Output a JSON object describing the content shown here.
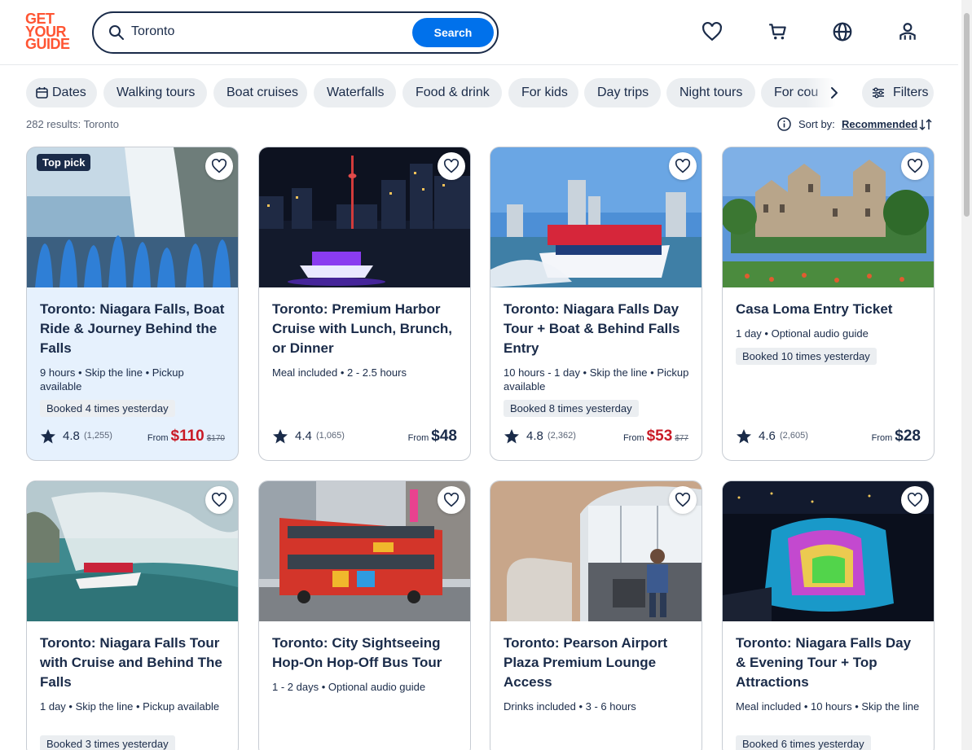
{
  "header": {
    "logo_lines": [
      "GET",
      "YOUR",
      "GUIDE"
    ],
    "search": {
      "value": "Toronto",
      "button_label": "Search"
    },
    "icons": [
      "heart-icon",
      "cart-icon",
      "globe-icon",
      "profile-icon"
    ]
  },
  "chips": [
    "Dates",
    "Walking tours",
    "Boat cruises",
    "Waterfalls",
    "Food & drink",
    "For kids",
    "Day trips",
    "Night tours",
    "For cou"
  ],
  "filters_label": "Filters",
  "results_text": "282 results: Toronto",
  "sort": {
    "label": "Sort by:",
    "value": "Recommended"
  },
  "colors": {
    "brand": "#ff5533",
    "accent": "#0071eb",
    "sale": "#c91a26",
    "text": "#1a2b49"
  },
  "cards": [
    {
      "badge": "Top pick",
      "title": "Toronto: Niagara Falls, Boat Ride & Journey Behind the Falls",
      "meta": "9 hours • Skip the line • Pickup available",
      "booked": "Booked 4 times yesterday",
      "rating": "4.8",
      "reviews": "(1,255)",
      "from": "From",
      "price": "$110",
      "old_price": "$170"
    },
    {
      "title": "Toronto: Premium Harbor Cruise with Lunch, Brunch, or Dinner",
      "meta": "Meal included • 2 - 2.5 hours",
      "rating": "4.4",
      "reviews": "(1,065)",
      "from": "From",
      "price": "$48"
    },
    {
      "title": "Toronto: Niagara Falls Day Tour + Boat & Behind Falls Entry",
      "meta": "10 hours - 1 day • Skip the line • Pickup available",
      "booked": "Booked 8 times yesterday",
      "rating": "4.8",
      "reviews": "(2,362)",
      "from": "From",
      "price": "$53",
      "old_price": "$77"
    },
    {
      "title": "Casa Loma Entry Ticket",
      "meta": "1 day • Optional audio guide",
      "booked": "Booked 10 times yesterday",
      "rating": "4.6",
      "reviews": "(2,605)",
      "from": "From",
      "price": "$28"
    },
    {
      "title": "Toronto: Niagara Falls Tour with Cruise and Behind The Falls",
      "meta": "1 day • Skip the line • Pickup available",
      "booked": "Booked 3 times yesterday"
    },
    {
      "title": "Toronto: City Sightseeing Hop-On Hop-Off Bus Tour",
      "meta": "1 - 2 days • Optional audio guide"
    },
    {
      "title": "Toronto: Pearson Airport Plaza Premium Lounge Access",
      "meta": "Drinks included • 3 - 6 hours"
    },
    {
      "title": "Toronto: Niagara Falls Day & Evening Tour + Top Attractions",
      "meta": "Meal included • 10 hours • Skip the line",
      "booked": "Booked 6 times yesterday"
    }
  ]
}
